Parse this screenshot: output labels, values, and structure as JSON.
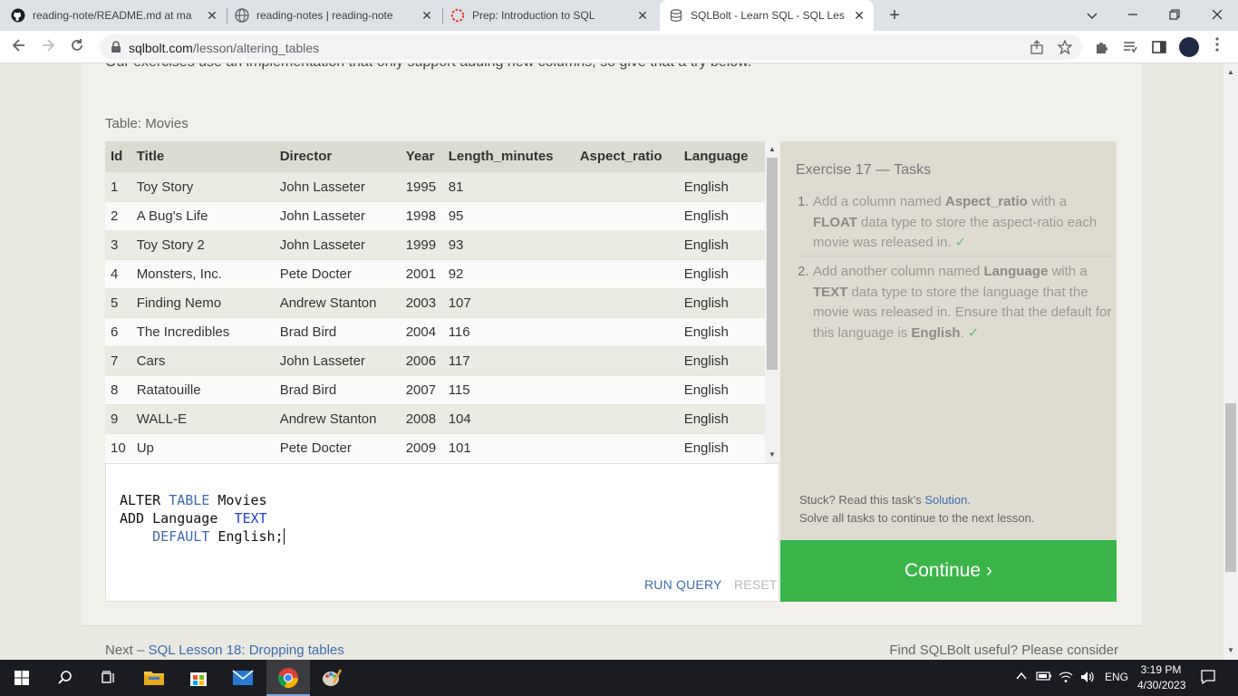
{
  "browser": {
    "tabs": [
      {
        "title": "reading-note/README.md at ma",
        "icon": "github-icon",
        "active": false
      },
      {
        "title": "reading-notes | reading-note",
        "icon": "globe-icon",
        "active": false
      },
      {
        "title": "Prep: Introduction to SQL",
        "icon": "canvas-icon",
        "active": false
      },
      {
        "title": "SQLBolt - Learn SQL - SQL Lesson",
        "icon": "database-icon",
        "active": true
      }
    ],
    "close_glyph": "✕",
    "new_tab_glyph": "+",
    "url_host": "sqlbolt.com",
    "url_path": "/lesson/altering_tables"
  },
  "page": {
    "cut_text": "Our exercises use an implementation that only support adding new columns, so give that a try below.",
    "table_caption": "Table: Movies",
    "columns": [
      "Id",
      "Title",
      "Director",
      "Year",
      "Length_minutes",
      "Aspect_ratio",
      "Language"
    ],
    "rows": [
      [
        "1",
        "Toy Story",
        "John Lasseter",
        "1995",
        "81",
        "",
        "English"
      ],
      [
        "2",
        "A Bug's Life",
        "John Lasseter",
        "1998",
        "95",
        "",
        "English"
      ],
      [
        "3",
        "Toy Story 2",
        "John Lasseter",
        "1999",
        "93",
        "",
        "English"
      ],
      [
        "4",
        "Monsters, Inc.",
        "Pete Docter",
        "2001",
        "92",
        "",
        "English"
      ],
      [
        "5",
        "Finding Nemo",
        "Andrew Stanton",
        "2003",
        "107",
        "",
        "English"
      ],
      [
        "6",
        "The Incredibles",
        "Brad Bird",
        "2004",
        "116",
        "",
        "English"
      ],
      [
        "7",
        "Cars",
        "John Lasseter",
        "2006",
        "117",
        "",
        "English"
      ],
      [
        "8",
        "Ratatouille",
        "Brad Bird",
        "2007",
        "115",
        "",
        "English"
      ],
      [
        "9",
        "WALL-E",
        "Andrew Stanton",
        "2008",
        "104",
        "",
        "English"
      ],
      [
        "10",
        "Up",
        "Pete Docter",
        "2009",
        "101",
        "",
        "English"
      ]
    ],
    "editor": {
      "line1_a": "ALTER ",
      "line1_kw": "TABLE",
      "line1_b": " Movies",
      "line2_a": "ADD Language  ",
      "line2_kw": "TEXT",
      "line3_indent": "    ",
      "line3_kw": "DEFAULT",
      "line3_b": " English;"
    },
    "run_label": "RUN QUERY",
    "reset_label": "RESET",
    "exercise_title": "Exercise 17 — Tasks",
    "task1": {
      "num": "1.",
      "t1": "Add a column named ",
      "b1": "Aspect_ratio",
      "t2": " with a ",
      "b2": "FLOAT",
      "t3": " data type to store the aspect-ratio each movie was released in.",
      "check": "✓"
    },
    "task2": {
      "num": "2.",
      "t1": "Add another column named ",
      "b1": "Language",
      "t2": " with a ",
      "b2": "TEXT",
      "t3": " data type to store the language that the movie was released in. Ensure that the default for this language is ",
      "b3": "English",
      "t4": ".",
      "check": "✓"
    },
    "stuck_prefix": "Stuck? Read this task's ",
    "solution_link": "Solution",
    "stuck_suffix": ".",
    "solve_all": "Solve all tasks to continue to the next lesson.",
    "continue_label": "Continue ›",
    "next_prefix": "Next – ",
    "next_link": "SQL Lesson 18: Dropping tables",
    "useful_text": "Find SQLBolt useful? Please consider"
  },
  "taskbar": {
    "lang": "ENG",
    "time": "3:19 PM",
    "date": "4/30/2023"
  },
  "colors": {
    "continue_green": "#3ab54a",
    "link_blue": "#3c6bb0",
    "check_green": "#6cb96f"
  }
}
